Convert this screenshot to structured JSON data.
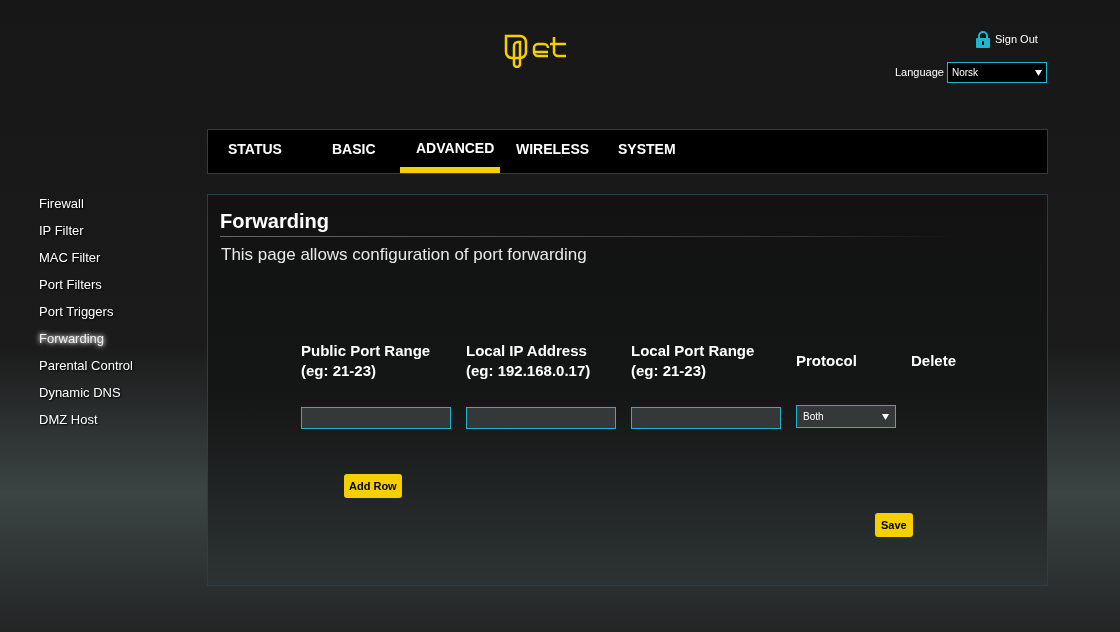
{
  "header": {
    "sign_out": "Sign Out",
    "language_label": "Language",
    "language_value": "Norsk"
  },
  "tabs": [
    {
      "label": "STATUS",
      "selected": false
    },
    {
      "label": "BASIC",
      "selected": false
    },
    {
      "label": "ADVANCED",
      "selected": true
    },
    {
      "label": "WIRELESS",
      "selected": false
    },
    {
      "label": "SYSTEM",
      "selected": false
    }
  ],
  "sidebar": {
    "items": [
      {
        "label": "Firewall",
        "selected": false
      },
      {
        "label": "IP Filter",
        "selected": false
      },
      {
        "label": "MAC Filter",
        "selected": false
      },
      {
        "label": "Port Filters",
        "selected": false
      },
      {
        "label": "Port Triggers",
        "selected": false
      },
      {
        "label": "Forwarding",
        "selected": true
      },
      {
        "label": "Parental Control",
        "selected": false
      },
      {
        "label": "Dynamic DNS",
        "selected": false
      },
      {
        "label": "DMZ Host",
        "selected": false
      }
    ]
  },
  "page": {
    "title": "Forwarding",
    "description": "This page allows configuration of port forwarding"
  },
  "table": {
    "columns": [
      {
        "label": "Public Port Range",
        "hint": "(eg: 21-23)"
      },
      {
        "label": "Local IP Address",
        "hint": "(eg: 192.168.0.17)"
      },
      {
        "label": "Local Port Range",
        "hint": "(eg: 21-23)"
      },
      {
        "label": "Protocol"
      },
      {
        "label": "Delete"
      }
    ],
    "rows": [
      {
        "public_port_range": "",
        "local_ip": "",
        "local_port_range": "",
        "protocol": "Both"
      }
    ]
  },
  "buttons": {
    "add_row": "Add Row",
    "save": "Save"
  }
}
